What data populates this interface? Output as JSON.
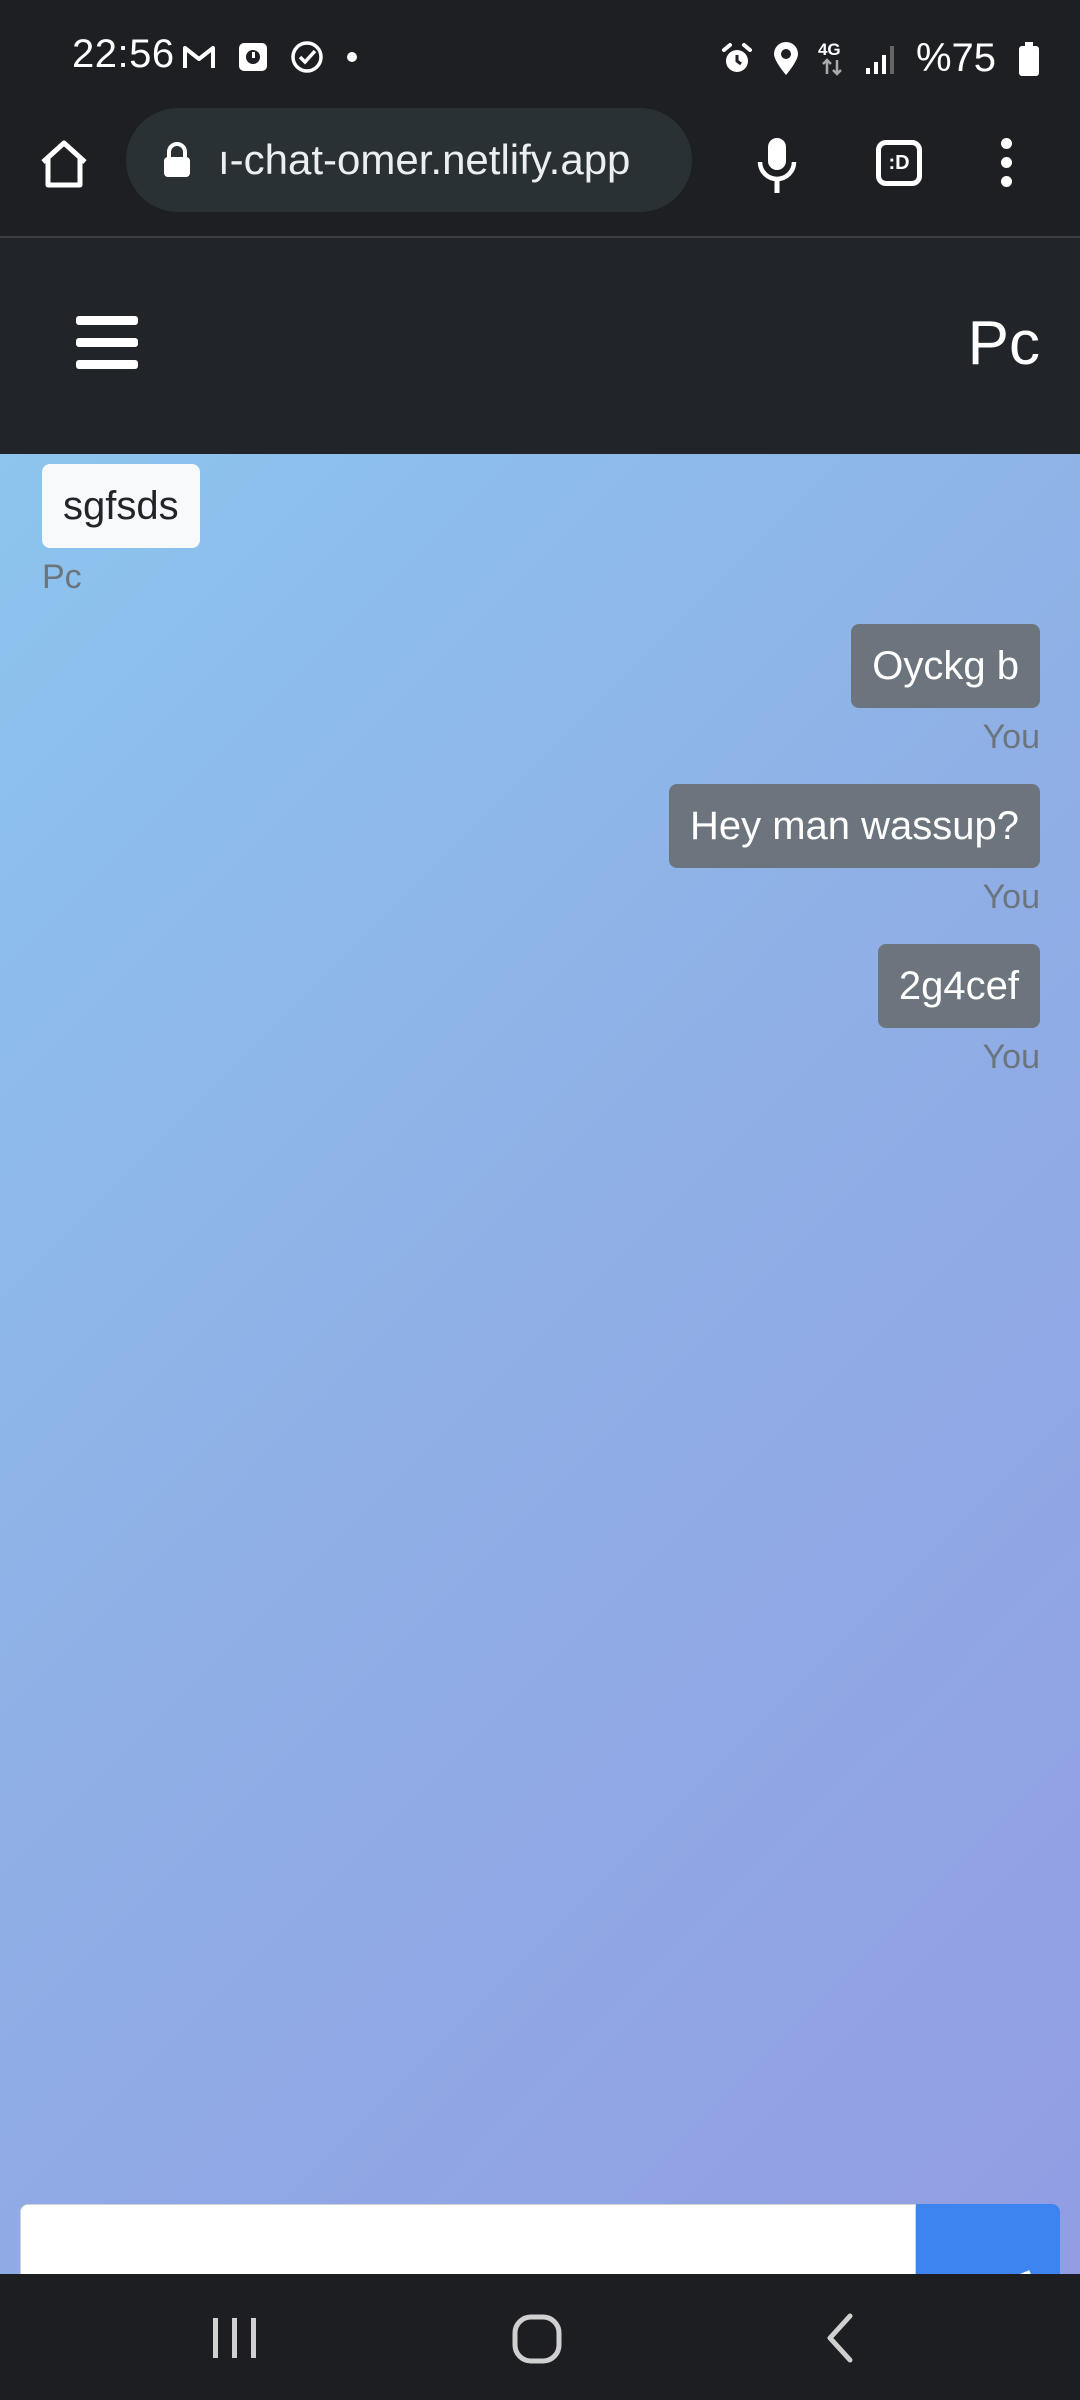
{
  "status_bar": {
    "time": "22:56",
    "network": "4G",
    "battery": "%75",
    "icons": [
      "gmail-icon",
      "notification-icon",
      "check-circle-icon",
      "dot-icon",
      "alarm-icon",
      "location-icon",
      "network-icon",
      "signal-icon",
      "battery-icon"
    ]
  },
  "browser": {
    "url": "ı-chat-omer.netlify.app",
    "tabs_label": ":D",
    "icons": [
      "home-icon",
      "lock-icon",
      "mic-icon",
      "tabs-icon",
      "more-menu-icon"
    ]
  },
  "app": {
    "title": "Pc",
    "menu_icon": "hamburger-icon"
  },
  "messages": [
    {
      "text": "sgfsds",
      "sender": "Pc",
      "side": "left"
    },
    {
      "text": "Oyckg b",
      "sender": "You",
      "side": "right"
    },
    {
      "text": "Hey man wassup?",
      "sender": "You",
      "side": "right"
    },
    {
      "text": "2g4cef",
      "sender": "You",
      "side": "right"
    }
  ],
  "composer": {
    "value": "",
    "send_icon": "send-icon"
  },
  "android_nav": {
    "icons": [
      "recent-apps-icon",
      "home-circle-icon",
      "back-icon"
    ]
  },
  "colors": {
    "navbar": "#212529",
    "bubble_incoming": "#f8f9fa",
    "bubble_outgoing": "#6c757d",
    "send_button": "#3d84f0",
    "gradient_start": "#8cc5ee",
    "gradient_end": "#929de3"
  }
}
